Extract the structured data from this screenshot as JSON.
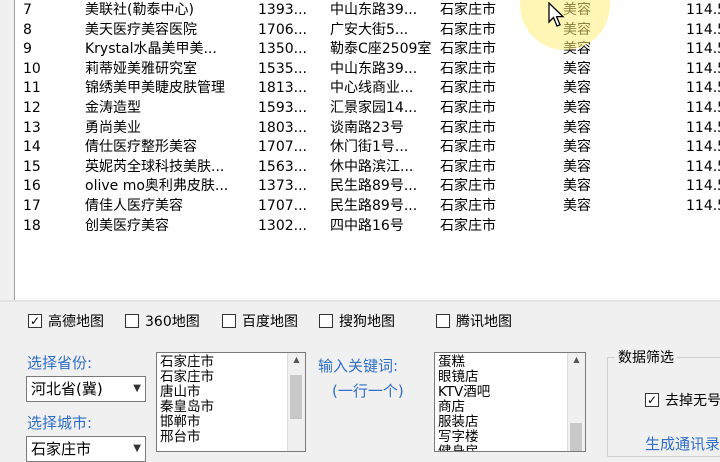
{
  "table": {
    "rows": [
      {
        "idx": "7",
        "name": "美联社(勒泰中心)",
        "phone": "1393...",
        "addr": "中山东路39...",
        "city": "石家庄市",
        "cat": "美容",
        "lng": "114.5"
      },
      {
        "idx": "8",
        "name": "美天医疗美容医院",
        "phone": "1706...",
        "addr": "广安大街5...",
        "city": "石家庄市",
        "cat": "美容",
        "lng": "114.5"
      },
      {
        "idx": "9",
        "name": "Krystal水晶美甲美...",
        "phone": "1350...",
        "addr": "勒泰C座2509室",
        "city": "石家庄市",
        "cat": "美容",
        "lng": "114.5"
      },
      {
        "idx": "10",
        "name": "莉蒂娅美雅研究室",
        "phone": "1535...",
        "addr": "中山东路39...",
        "city": "石家庄市",
        "cat": "美容",
        "lng": "114.5"
      },
      {
        "idx": "11",
        "name": "锦绣美甲美睫皮肤管理",
        "phone": "1813...",
        "addr": "中心线商业...",
        "city": "石家庄市",
        "cat": "美容",
        "lng": "114.5"
      },
      {
        "idx": "12",
        "name": "金涛造型",
        "phone": "1593...",
        "addr": "汇景家园14...",
        "city": "石家庄市",
        "cat": "美容",
        "lng": "114.5"
      },
      {
        "idx": "13",
        "name": "勇尚美业",
        "phone": "1803...",
        "addr": "谈南路23号",
        "city": "石家庄市",
        "cat": "美容",
        "lng": "114.5"
      },
      {
        "idx": "14",
        "name": "倩仕医疗整形美容",
        "phone": "1707...",
        "addr": "休门街1号...",
        "city": "石家庄市",
        "cat": "美容",
        "lng": "114.5"
      },
      {
        "idx": "15",
        "name": "英妮芮全球科技美肤...",
        "phone": "1563...",
        "addr": "休中路滨江...",
        "city": "石家庄市",
        "cat": "美容",
        "lng": "114.5"
      },
      {
        "idx": "16",
        "name": "olive mo奥利弗皮肤...",
        "phone": "1373...",
        "addr": "民生路89号...",
        "city": "石家庄市",
        "cat": "美容",
        "lng": "114.5"
      },
      {
        "idx": "17",
        "name": "倩佳人医疗美容",
        "phone": "1707...",
        "addr": "民生路89号...",
        "city": "石家庄市",
        "cat": "美容",
        "lng": "114.5"
      },
      {
        "idx": "18",
        "name": "创美医疗美容",
        "phone": "1302...",
        "addr": "四中路16号",
        "city": "石家庄市",
        "cat": "",
        "lng": ""
      }
    ]
  },
  "maps": [
    {
      "label": "高德地图",
      "checked": true
    },
    {
      "label": "360地图",
      "checked": false
    },
    {
      "label": "百度地图",
      "checked": false
    },
    {
      "label": "搜狗地图",
      "checked": false
    },
    {
      "label": "腾讯地图",
      "checked": false
    }
  ],
  "province": {
    "label": "选择省份:",
    "value": "河北省(冀)"
  },
  "city_select": {
    "label": "选择城市:",
    "value": "石家庄市"
  },
  "city_list": [
    "石家庄市",
    "石家庄市",
    "唐山市",
    "秦皇岛市",
    "邯郸市",
    "邢台市"
  ],
  "keywords": {
    "label": "输入关键词:",
    "hint": "(一行一个)",
    "items": [
      "蛋糕",
      "眼镜店",
      "KTV酒吧",
      "商店",
      "服装店",
      "写字楼",
      "健身房"
    ]
  },
  "filter": {
    "title": "数据筛选",
    "option": "去掉无号",
    "option_checked": true,
    "action": "生成通讯录"
  },
  "colors": {
    "accent": "#2f6fc8"
  }
}
